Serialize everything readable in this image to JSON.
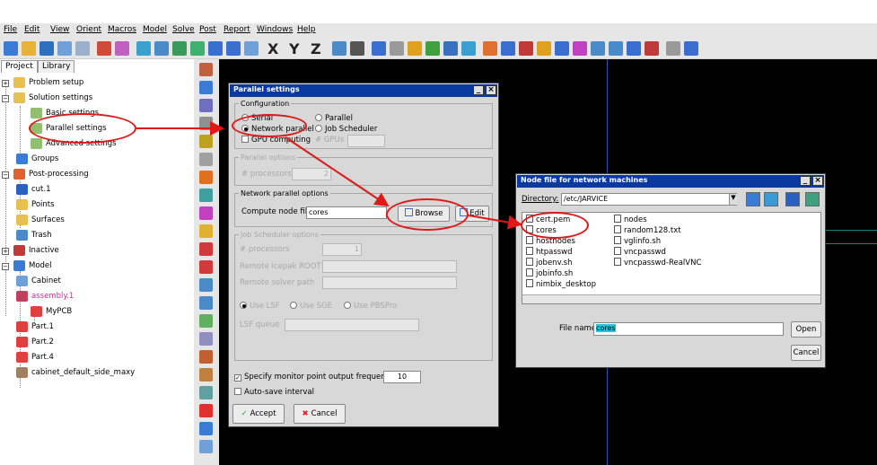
{
  "menu": [
    "File",
    "Edit",
    "View",
    "Orient",
    "Macros",
    "Model",
    "Solve",
    "Post",
    "Report",
    "Windows",
    "Help"
  ],
  "toolbar_axes": [
    "X",
    "Y",
    "Z"
  ],
  "project_tabs": [
    "Project",
    "Library"
  ],
  "tree": {
    "problem_setup": "Problem setup",
    "solution_settings": "Solution settings",
    "basic_settings": "Basic settings",
    "parallel_settings": "Parallel settings",
    "advanced_settings": "Advanced settings",
    "groups": "Groups",
    "post_processing": "Post-processing",
    "cut1": "cut.1",
    "points": "Points",
    "surfaces": "Surfaces",
    "trash": "Trash",
    "inactive": "Inactive",
    "model": "Model",
    "cabinet": "Cabinet",
    "assembly": "assembly.1",
    "mypcb": "MyPCB",
    "part1": "Part.1",
    "part2": "Part.2",
    "part4": "Part.4",
    "side": "cabinet_default_side_maxy"
  },
  "parallel": {
    "title": "Parallel settings",
    "configuration": "Configuration",
    "serial": "Serial",
    "parallel": "Parallel",
    "network_parallel": "Network parallel",
    "job_scheduler": "Job Scheduler",
    "gpu_computing": "GPU computing",
    "gpus": "# GPUs",
    "parallel_options": "Parallel options",
    "processors": "# processors",
    "processors_value": "2",
    "network_options": "Network parallel options",
    "compute_node_file": "Compute node file",
    "compute_node_value": "cores",
    "browse": "Browse",
    "edit": "Edit",
    "job_scheduler_options": "Job Scheduler options",
    "js_processors": "# processors",
    "js_processors_value": "1",
    "remote_root": "Remote Icepak ROOT",
    "remote_path": "Remote solver path",
    "use_lsf": "Use LSF",
    "use_sge": "Use SGE",
    "use_pbspro": "Use PBSPro",
    "lsf_queue": "LSF queue",
    "monitor": "Specify monitor point output frequency",
    "monitor_value": "10",
    "autosave": "Auto-save interval",
    "accept": "Accept",
    "cancel": "Cancel"
  },
  "nodefile": {
    "title": "Node file for network machines",
    "directory_label": "Directory:",
    "directory_value": "/etc/JARVICE",
    "files_left": [
      "cert.pem",
      "cores",
      "hostnodes",
      "htpasswd",
      "jobenv.sh",
      "jobinfo.sh",
      "nimbix_desktop"
    ],
    "files_right": [
      "nodes",
      "random128.txt",
      "vglinfo.sh",
      "vncpasswd",
      "vncpasswd-RealVNC"
    ],
    "file_name_label": "File name:",
    "file_name_value": "cores",
    "open": "Open",
    "cancel": "Cancel"
  },
  "colors": {
    "titlebar": "#0a3aa0",
    "annotation": "#e01818",
    "viewport": "#000000"
  }
}
